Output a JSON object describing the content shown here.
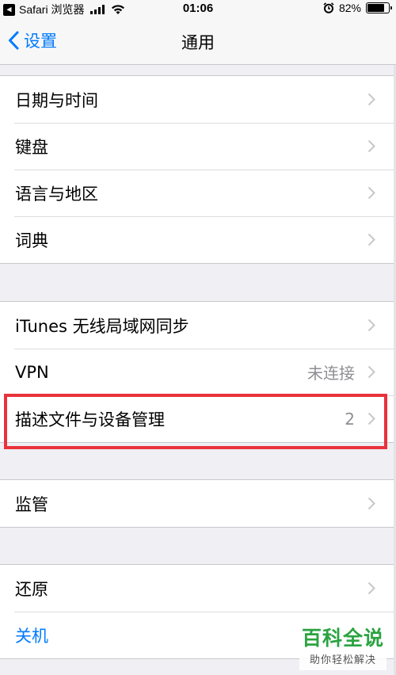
{
  "status_bar": {
    "back_app_icon": "back-to-app-icon",
    "carrier": "Safari 浏览器",
    "time": "01:06",
    "battery_percent": "82%",
    "battery_level": 0.82
  },
  "nav": {
    "back_label": "设置",
    "title": "通用"
  },
  "groups": [
    {
      "items": [
        {
          "label": "日期与时间"
        },
        {
          "label": "键盘"
        },
        {
          "label": "语言与地区"
        },
        {
          "label": "词典"
        }
      ]
    },
    {
      "items": [
        {
          "label": "iTunes 无线局域网同步"
        },
        {
          "label": "VPN",
          "value": "未连接"
        },
        {
          "label": "描述文件与设备管理",
          "value": "2"
        }
      ]
    },
    {
      "items": [
        {
          "label": "监管"
        }
      ]
    },
    {
      "items": [
        {
          "label": "还原"
        },
        {
          "label": "关机"
        }
      ]
    }
  ],
  "watermark": {
    "title": "百科全说",
    "subtitle": "助你轻松解决"
  },
  "colors": {
    "accent": "#007aff",
    "highlight": "#e8323c",
    "watermark_green": "#2aa341"
  }
}
